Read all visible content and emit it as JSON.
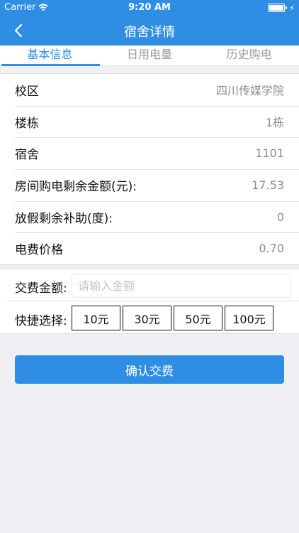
{
  "status_bar": {
    "carrier": "Carrier",
    "time": "9:20 AM",
    "battery_level": 1.0,
    "wifi_icon": "wifi-icon",
    "battery_icon": "battery-icon",
    "charging_icon": "charging-bolt-icon"
  },
  "nav": {
    "title": "宿舍详情",
    "back_icon": "chevron-left-icon"
  },
  "tabs": [
    {
      "label": "基本信息",
      "active": true
    },
    {
      "label": "日用电量",
      "active": false
    },
    {
      "label": "历史购电",
      "active": false
    }
  ],
  "info": [
    {
      "label": "校区",
      "value": "四川传媒学院"
    },
    {
      "label": "楼栋",
      "value": "1栋"
    },
    {
      "label": "宿舍",
      "value": "1101"
    },
    {
      "label": "房间购电剩余金额(元):",
      "value": "17.53"
    },
    {
      "label": "放假剩余补助(度):",
      "value": "0"
    },
    {
      "label": "电费价格",
      "value": "0.70"
    }
  ],
  "payment": {
    "amount_label": "交费金额:",
    "amount_value": "",
    "amount_placeholder": "请输入金额",
    "quick_label": "快捷选择:",
    "quick_options": [
      "10元",
      "30元",
      "50元",
      "100元"
    ]
  },
  "confirm_label": "确认交费",
  "colors": {
    "accent": "#2f8ee3",
    "background": "#efeff4",
    "muted_text": "#8c8c8c"
  }
}
